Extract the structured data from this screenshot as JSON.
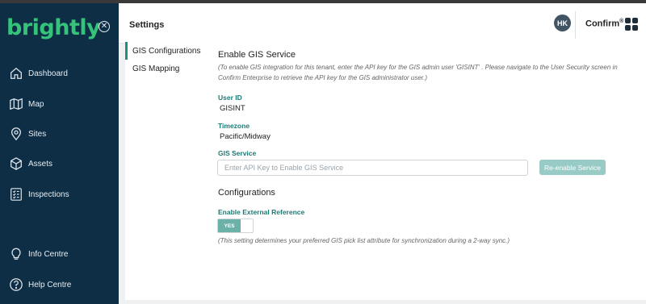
{
  "brand": {
    "logo_text": "brightly",
    "accent": "#35c37a"
  },
  "sidebar": {
    "background": "#0e2e46",
    "collapse_icon": "close-circle-icon",
    "items": [
      {
        "label": "Dashboard",
        "icon": "home-icon"
      },
      {
        "label": "Map",
        "icon": "map-icon"
      },
      {
        "label": "Sites",
        "icon": "location-pin-icon"
      },
      {
        "label": "Assets",
        "icon": "cube-icon"
      },
      {
        "label": "Inspections",
        "icon": "checklist-icon"
      },
      {
        "label": "Info Centre",
        "icon": "lightbulb-icon"
      },
      {
        "label": "Help Centre",
        "icon": "question-circle-icon"
      }
    ]
  },
  "header": {
    "title": "Settings",
    "avatar_initials": "HK",
    "app_name": "Confirm",
    "app_mark": "®",
    "apps_icon": "app-grid-icon"
  },
  "settings_nav": {
    "items": [
      {
        "label": "GIS Configurations",
        "active": true
      },
      {
        "label": "GIS Mapping",
        "active": false
      }
    ]
  },
  "content": {
    "section_title": "Enable GIS Service",
    "help_text": "(To enable GIS integration for this tenant, enter the API key for the GIS admin user 'GISINT' . Please navigate to the User Security screen in Confirm Enterprise to retrieve the API key for the GIS administrator user.)",
    "user_id_label": "User ID",
    "user_id_value": "GISINT",
    "timezone_label": "Timezone",
    "timezone_value": "Pacific/Midway",
    "gis_service_label": "GIS Service",
    "api_key_placeholder": "Enter API Key to Enable GIS Service",
    "api_key_value": "",
    "reenable_button": "Re-enable Service",
    "configurations_title": "Configurations",
    "external_ref_label": "Enable External Reference",
    "toggle_label": "YES",
    "toggle_state": true,
    "sync_note": "(This setting determines your preferred GIS pick list attribute for synchronization during a 2-way sync.)"
  }
}
